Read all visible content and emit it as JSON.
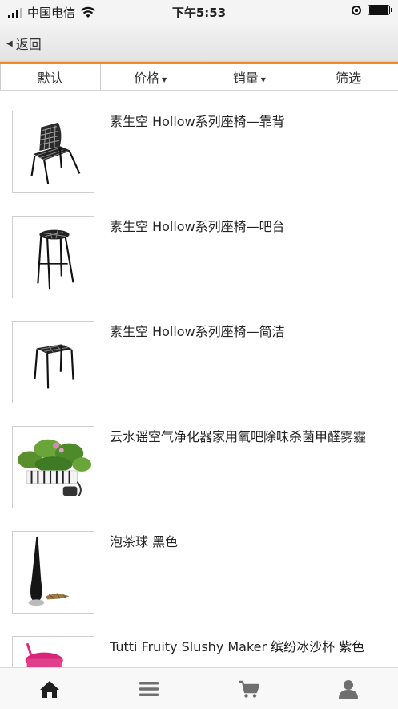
{
  "status_bar": {
    "carrier": "中国电信",
    "time": "下午5:53"
  },
  "nav": {
    "back_label": "返回"
  },
  "tabs": [
    {
      "label": "默认",
      "active": true,
      "caret": false
    },
    {
      "label": "价格",
      "active": false,
      "caret": true
    },
    {
      "label": "销量",
      "active": false,
      "caret": true
    },
    {
      "label": "筛选",
      "active": false,
      "caret": false
    }
  ],
  "products": [
    {
      "title": "素生空 Hollow系列座椅—靠背",
      "image": "chair-back-image"
    },
    {
      "title": "素生空 Hollow系列座椅—吧台",
      "image": "bar-stool-image"
    },
    {
      "title": "素生空 Hollow系列座椅—简洁",
      "image": "simple-stool-image"
    },
    {
      "title": "云水谣空气净化器家用氧吧除味杀菌甲醛雾霾",
      "image": "plant-purifier-image"
    },
    {
      "title": "泡茶球 黑色",
      "image": "tea-infuser-image"
    },
    {
      "title": "Tutti Fruity Slushy Maker 缤纷冰沙杯 紫色",
      "image": "slushy-cup-image"
    }
  ],
  "bottom_tabs": [
    {
      "icon": "home-icon"
    },
    {
      "icon": "menu-icon"
    },
    {
      "icon": "cart-icon"
    },
    {
      "icon": "user-icon"
    }
  ],
  "colors": {
    "accent": "#f08a24",
    "icon_active": "#222222",
    "icon_inactive": "#6f6f6f"
  }
}
